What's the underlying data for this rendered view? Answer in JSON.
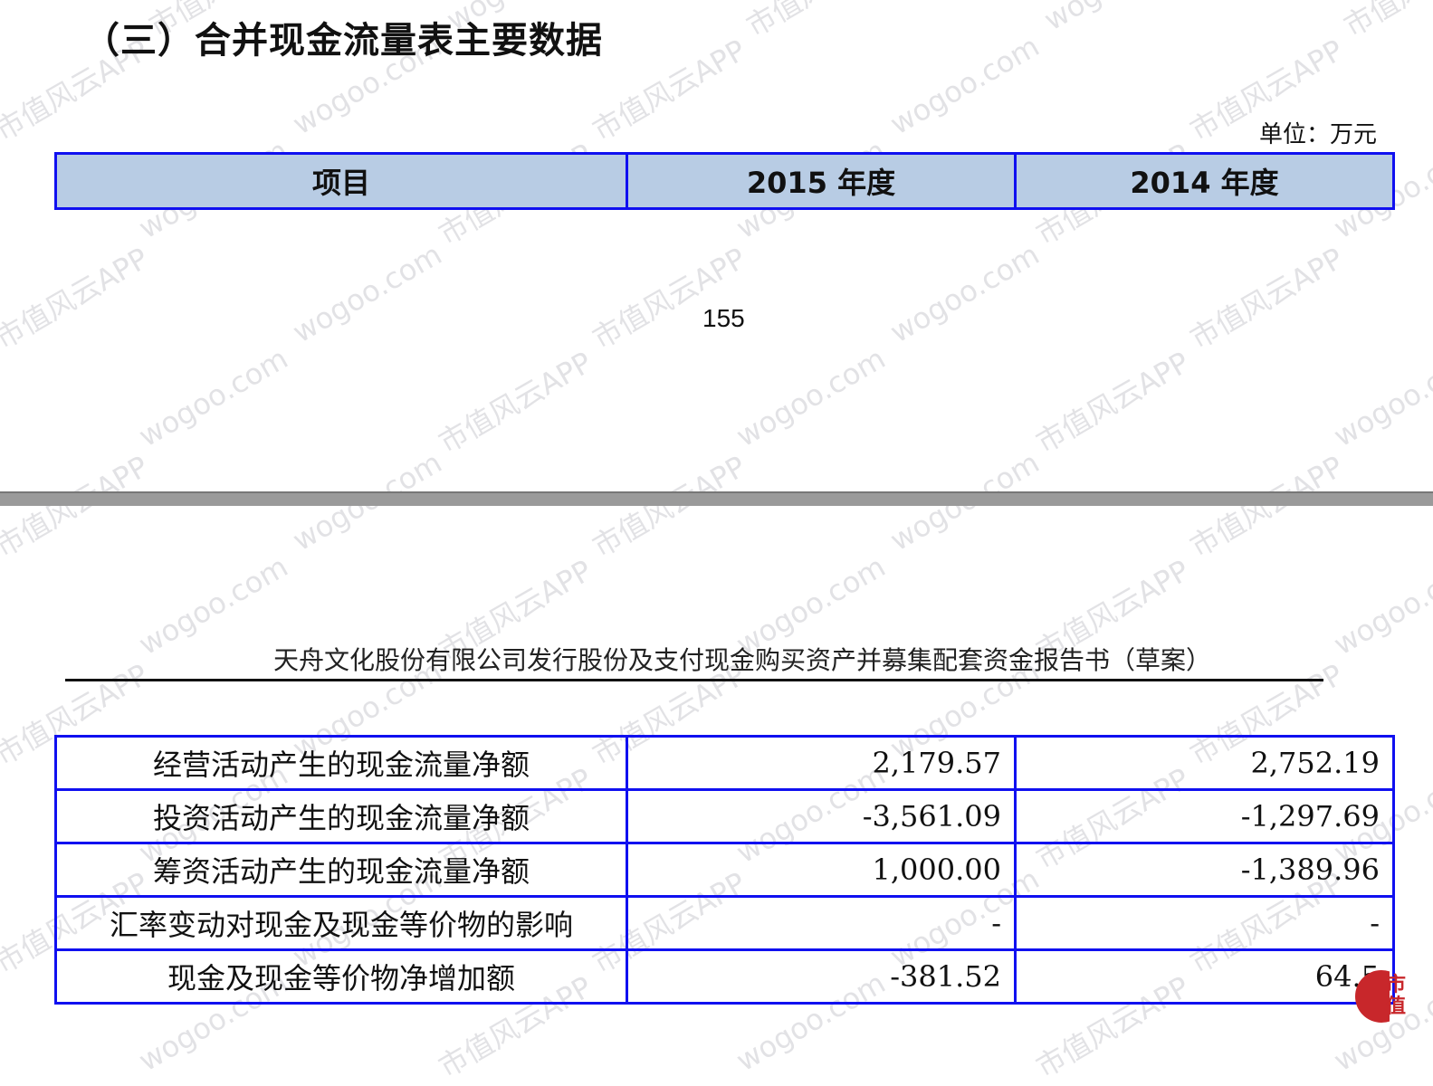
{
  "title": "（三）合并现金流量表主要数据",
  "unit": "单位：万元",
  "header": [
    "项目",
    "2015 年度",
    "2014 年度"
  ],
  "page_number": "155",
  "running_header": "天舟文化股份有限公司发行股份及支付现金购买资产并募集配套资金报告书（草案）",
  "rows": [
    {
      "item": "经营活动产生的现金流量净额",
      "y2015": "2,179.57",
      "y2014": "2,752.19"
    },
    {
      "item": "投资活动产生的现金流量净额",
      "y2015": "-3,561.09",
      "y2014": "-1,297.69"
    },
    {
      "item": "筹资活动产生的现金流量净额",
      "y2015": "1,000.00",
      "y2014": "-1,389.96"
    },
    {
      "item": "汇率变动对现金及现金等价物的影响",
      "y2015": "-",
      "y2014": "-"
    },
    {
      "item": "现金及现金等价物净增加额",
      "y2015": "-381.52",
      "y2014": "64.5"
    }
  ],
  "watermark": {
    "text_a": "市值风云APP",
    "text_b": "wogoo.com"
  },
  "logo": {
    "text": "市值",
    "color": "#c8272b"
  },
  "colors": {
    "table_border": "#1010f0",
    "header_bg": "#b8cce4"
  }
}
